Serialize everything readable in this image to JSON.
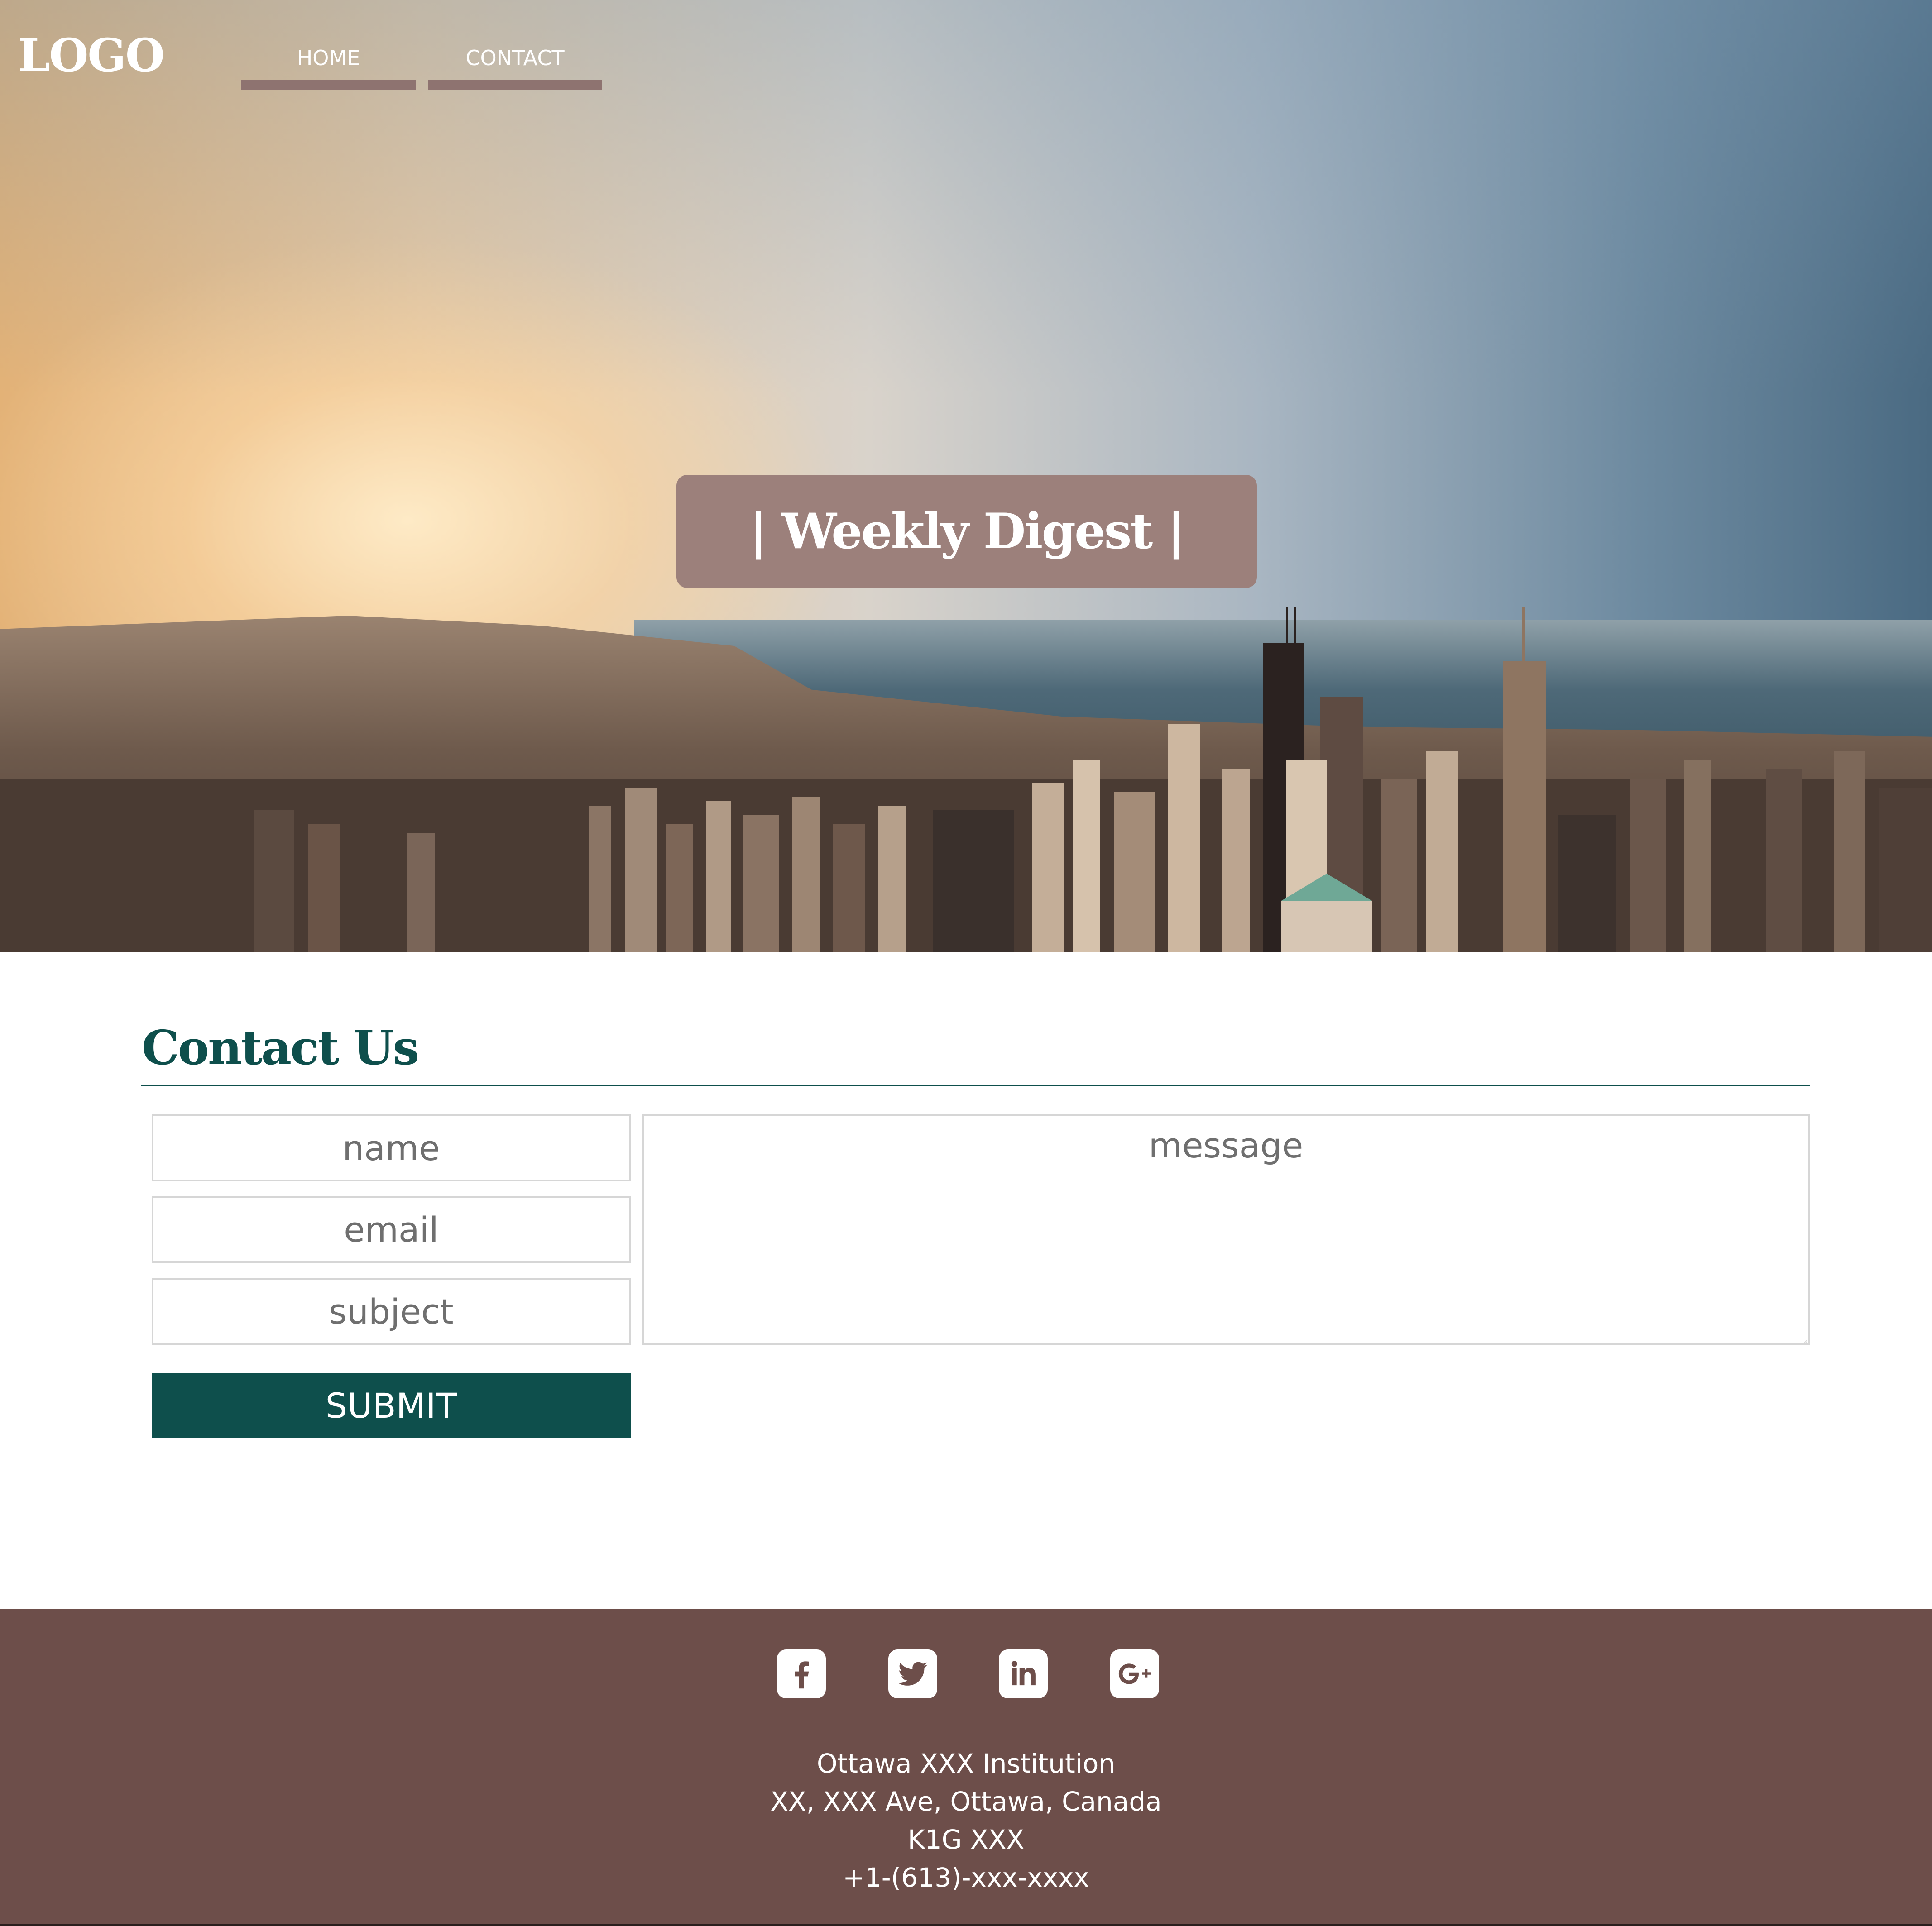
{
  "header": {
    "logo": "LOGO",
    "nav": [
      {
        "label": "HOME"
      },
      {
        "label": "CONTACT"
      }
    ]
  },
  "hero": {
    "title": "| Weekly Digest |"
  },
  "contact": {
    "heading": "Contact Us",
    "fields": {
      "name_placeholder": "name",
      "email_placeholder": "email",
      "subject_placeholder": "subject",
      "message_placeholder": "message"
    },
    "submit_label": "SUBMIT"
  },
  "footer": {
    "social_icons": [
      "facebook-icon",
      "twitter-icon",
      "linkedin-icon",
      "googleplus-icon"
    ],
    "address_lines": [
      "Ottawa XXX Institution",
      "XX, XXX Ave, Ottawa, Canada",
      "K1G XXX",
      "+1-(613)-xxx-xxxx"
    ]
  },
  "colors": {
    "accent_teal": "#0e4f4c",
    "nav_underline": "#8e7370",
    "title_box": "#9c807b",
    "footer_bg": "#6d4e4a"
  }
}
